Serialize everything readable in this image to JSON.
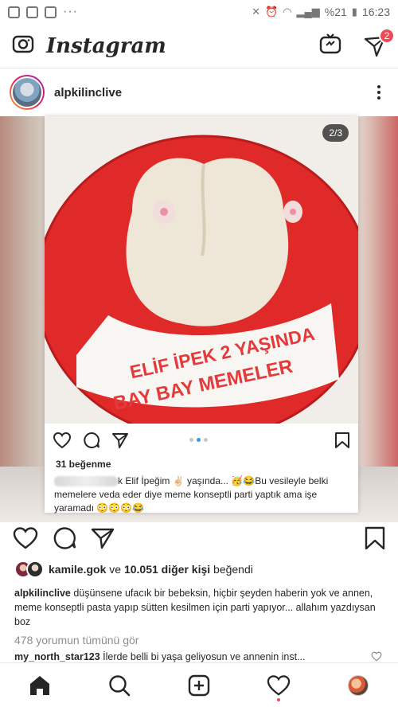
{
  "status_bar": {
    "battery": "%21",
    "time": "16:23",
    "menu_dots": "···"
  },
  "header": {
    "brand": "Instagram",
    "dm_badge": "2"
  },
  "post": {
    "username": "alpkilinclive",
    "image_counter": "2/3",
    "cake_text_line1": "ELİF İPEK 2 YAŞINDA",
    "cake_text_line2": "BAY BAY MEMELER",
    "inner": {
      "likes": "31 beğenme",
      "caption": "k Elif İpeğim ✌🏻 yaşında... 🥳😂Bu vesileyle belki memelere veda eder diye meme konseptli parti yaptık ama işe yaramadı 😳😳😳😂"
    },
    "liked_by_user": "kamile.gok",
    "liked_by_connector": " ve ",
    "liked_by_others": "10.051 diğer kişi",
    "liked_by_suffix": " beğendi",
    "caption_user": "alpkilinclive",
    "caption_text": " düşünsene ufacık bir bebeksin, hiçbir şeyden haberin yok ve annen, meme konseptli pasta yapıp sütten kesilmen için parti yapıyor... allahım yazdıysan boz",
    "view_comments": "478 yorumun tümünü gör",
    "top_comment_user": "my_north_star123",
    "top_comment_text": " İlerde belli bi yaşa geliyosun ve annenin inst..."
  },
  "colors": {
    "accent_blue": "#3897f0",
    "badge_red": "#ed4956",
    "cake_red": "#e02a2a"
  }
}
